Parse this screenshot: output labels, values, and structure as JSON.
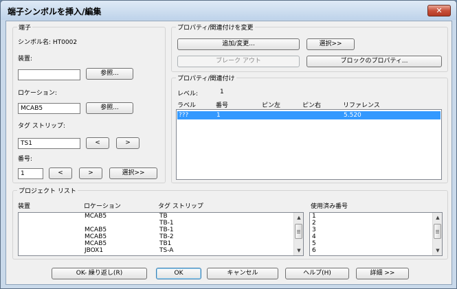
{
  "window": {
    "title": "端子シンボルを挿入/編集",
    "close_label": "✕"
  },
  "terminal": {
    "group_title": "端子",
    "symbol_name": "シンボル名: HT0002",
    "device_label": "装置:",
    "device_value": "",
    "browse1": "参照...",
    "location_label": "ロケーション:",
    "location_value": "MCAB5",
    "browse2": "参照...",
    "tagstrip_label": "タグ ストリップ:",
    "tagstrip_value": "TS1",
    "prev": "<",
    "next": ">",
    "number_label": "番号:",
    "number_value": "1",
    "prev2": "<",
    "next2": ">",
    "select": "選択>>"
  },
  "property_change": {
    "group_title": "プロパティ/関連付けを変更",
    "add_change": "追加/変更...",
    "select": "選択>>",
    "breakout": "ブレーク アウト",
    "block_properties": "ブロックのプロパティ..."
  },
  "associations": {
    "group_title": "プロパティ/関連付け",
    "level_label": "レベル:",
    "level_value": "1",
    "columns": [
      "ラベル",
      "番号",
      "ピン左",
      "ピン右",
      "リファレンス"
    ],
    "rows": [
      {
        "label": "???",
        "number": "1",
        "pin_left": "",
        "pin_right": "",
        "reference": "5.520"
      }
    ]
  },
  "project_list": {
    "group_title": "プロジェクト リスト",
    "columns": [
      "装置",
      "ロケーション",
      "タグ ストリップ",
      "使用済み番号"
    ],
    "rows": [
      {
        "device": "",
        "location": "MCAB5",
        "tagstrip": "TB"
      },
      {
        "device": "",
        "location": "",
        "tagstrip": "TB-1"
      },
      {
        "device": "",
        "location": "MCAB5",
        "tagstrip": "TB-1"
      },
      {
        "device": "",
        "location": "MCAB5",
        "tagstrip": "TB-2"
      },
      {
        "device": "",
        "location": "MCAB5",
        "tagstrip": "TB1"
      },
      {
        "device": "",
        "location": "JBOX1",
        "tagstrip": "TS-A"
      }
    ],
    "used_numbers": [
      "1",
      "2",
      "3",
      "4",
      "5",
      "6"
    ]
  },
  "footer": {
    "ok_repeat": "OK- 繰り返し(R)",
    "ok": "OK",
    "cancel": "キャンセル",
    "help": "ヘルプ(H)",
    "details": "詳細 >>"
  }
}
